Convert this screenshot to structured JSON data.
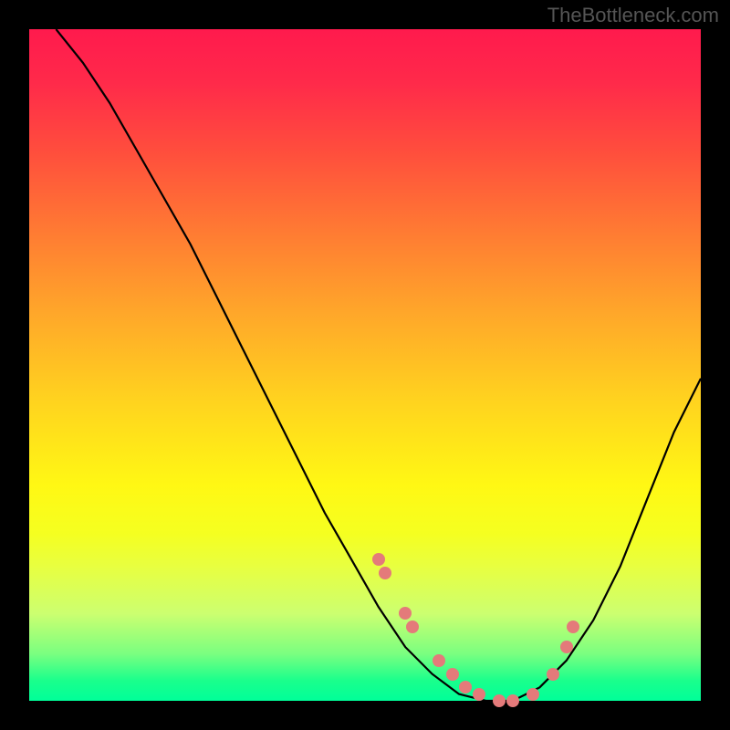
{
  "watermark": "TheBottleneck.com",
  "chart_data": {
    "type": "line",
    "title": "",
    "xlabel": "",
    "ylabel": "",
    "xlim": [
      0,
      100
    ],
    "ylim": [
      0,
      100
    ],
    "series": [
      {
        "name": "curve",
        "x": [
          4,
          8,
          12,
          16,
          20,
          24,
          28,
          32,
          36,
          40,
          44,
          48,
          52,
          56,
          60,
          64,
          68,
          72,
          76,
          80,
          84,
          88,
          92,
          96,
          100
        ],
        "y": [
          100,
          95,
          89,
          82,
          75,
          68,
          60,
          52,
          44,
          36,
          28,
          21,
          14,
          8,
          4,
          1,
          0,
          0,
          2,
          6,
          12,
          20,
          30,
          40,
          48
        ]
      }
    ],
    "scatter_points": {
      "name": "markers",
      "x": [
        52,
        53,
        56,
        57,
        61,
        63,
        65,
        67,
        70,
        72,
        75,
        78,
        80,
        81
      ],
      "y": [
        21,
        19,
        13,
        11,
        6,
        4,
        2,
        1,
        0,
        0,
        1,
        4,
        8,
        11
      ]
    },
    "background_gradient": {
      "top": "#ff1a4d",
      "mid": "#ffe020",
      "bottom": "#00ff99"
    }
  }
}
